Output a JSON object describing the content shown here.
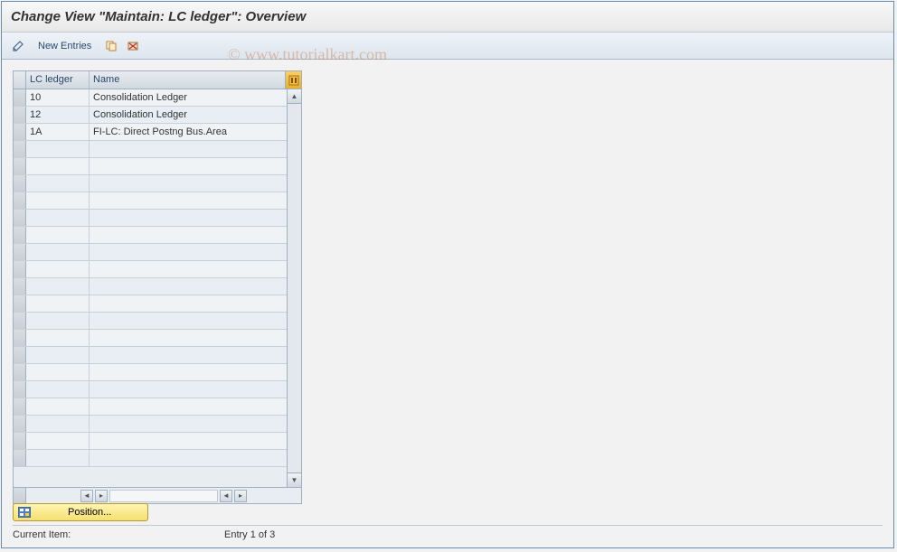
{
  "title": "Change View \"Maintain: LC ledger\": Overview",
  "toolbar": {
    "new_entries": "New Entries"
  },
  "watermark": "© www.tutorialkart.com",
  "table": {
    "header_lc": "LC ledger",
    "header_name": "Name",
    "rows": [
      {
        "lc": "10",
        "name": "Consolidation Ledger"
      },
      {
        "lc": "12",
        "name": "Consolidation Ledger"
      },
      {
        "lc": "1A",
        "name": "FI-LC: Direct Postng Bus.Area"
      }
    ]
  },
  "footer": {
    "position": "Position...",
    "current_item_label": "Current Item:",
    "entry_text": "Entry 1 of 3"
  }
}
